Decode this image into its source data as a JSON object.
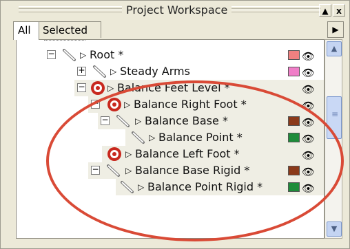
{
  "window": {
    "title": "Project Workspace",
    "pin_label": "▲",
    "close_label": "x"
  },
  "tabs": [
    {
      "label": "All"
    },
    {
      "label": "Selected"
    }
  ],
  "tab_scroll_label": "▶",
  "scrollbar": {
    "up_label": "▲",
    "down_label": "▼"
  },
  "colors": {
    "accent": "#d94a36"
  },
  "tree": {
    "rows": [
      {
        "label": "Root *",
        "expander": "−",
        "icon": "bone-icon",
        "swatch": "#f08080",
        "visibility": "hidden-eye-icon"
      },
      {
        "label": "Steady Arms",
        "expander": "+",
        "icon": "bone-icon",
        "swatch": "#f07ec8",
        "visibility": "hidden-eye-icon"
      },
      {
        "label": "Balance Feet Level *",
        "expander": "−",
        "icon": "target-icon",
        "swatch": "",
        "visibility": "eye-icon"
      },
      {
        "label": "Balance Right Foot *",
        "expander": "−",
        "icon": "target-icon",
        "swatch": "",
        "visibility": "eye-icon"
      },
      {
        "label": "Balance Base *",
        "expander": "−",
        "icon": "bone-icon",
        "swatch": "#8b3a1a",
        "visibility": "eye-icon"
      },
      {
        "label": "Balance Point *",
        "expander": "",
        "icon": "bone-icon",
        "swatch": "#1e8c3a",
        "visibility": "eye-icon"
      },
      {
        "label": "Balance Left Foot *",
        "expander": "",
        "icon": "target-icon",
        "swatch": "",
        "visibility": "eye-icon"
      },
      {
        "label": "Balance Base Rigid *",
        "expander": "−",
        "icon": "bone-icon",
        "swatch": "#8b3a1a",
        "visibility": "eye-icon"
      },
      {
        "label": "Balance Point Rigid *",
        "expander": "",
        "icon": "bone-icon",
        "swatch": "#1e8c3a",
        "visibility": "eye-icon"
      }
    ]
  }
}
